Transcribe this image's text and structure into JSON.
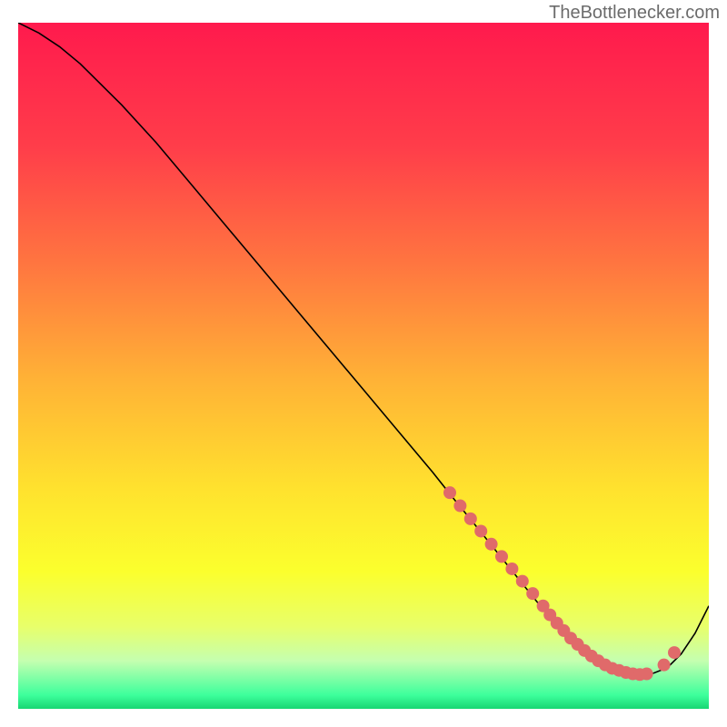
{
  "attribution": "TheBottlenecker.com",
  "chart_data": {
    "type": "line",
    "title": "",
    "xlabel": "",
    "ylabel": "",
    "xlim": [
      0,
      100
    ],
    "ylim": [
      0,
      100
    ],
    "background_type": "vertical_rainbow_gradient",
    "gradient_stops": [
      {
        "offset": 0,
        "color": "#ff1a4d"
      },
      {
        "offset": 0.18,
        "color": "#ff3d4a"
      },
      {
        "offset": 0.35,
        "color": "#ff7540"
      },
      {
        "offset": 0.52,
        "color": "#ffb236"
      },
      {
        "offset": 0.68,
        "color": "#ffe22e"
      },
      {
        "offset": 0.8,
        "color": "#fbff2d"
      },
      {
        "offset": 0.88,
        "color": "#e8ff6a"
      },
      {
        "offset": 0.93,
        "color": "#c5ffb0"
      },
      {
        "offset": 0.98,
        "color": "#3dff9c"
      },
      {
        "offset": 1.0,
        "color": "#18d673"
      }
    ],
    "series": [
      {
        "name": "bottleneck-curve",
        "color": "#000000",
        "stroke_width": 1.6,
        "x": [
          0,
          3,
          6,
          9,
          12,
          15,
          20,
          25,
          30,
          35,
          40,
          45,
          50,
          55,
          60,
          63,
          66,
          68,
          70,
          72,
          74,
          76,
          78,
          80,
          82,
          84,
          86,
          88,
          90,
          92,
          94,
          96,
          98,
          100
        ],
        "y": [
          100,
          98.5,
          96.5,
          94,
          91,
          88,
          82.5,
          76.5,
          70.5,
          64.5,
          58.5,
          52.5,
          46.5,
          40.5,
          34.5,
          30.7,
          27,
          24.5,
          22,
          19.5,
          17,
          14.5,
          12.2,
          10.2,
          8.5,
          7,
          5.9,
          5.2,
          5,
          5.2,
          6,
          8,
          11,
          15
        ]
      }
    ],
    "markers": [
      {
        "name": "data-cluster",
        "color": "#e06a6a",
        "size": 7,
        "x": [
          62.5,
          64,
          65.5,
          67,
          68.5,
          70,
          71.5,
          73,
          74.5,
          76,
          77,
          78,
          79,
          80,
          81,
          82,
          83,
          84,
          85,
          86,
          87,
          88,
          89,
          90,
          91,
          93.5,
          95
        ],
        "y": [
          31.5,
          29.6,
          27.7,
          25.9,
          24,
          22.2,
          20.4,
          18.6,
          16.8,
          15,
          13.7,
          12.5,
          11.4,
          10.3,
          9.4,
          8.5,
          7.7,
          7,
          6.4,
          5.9,
          5.6,
          5.3,
          5.1,
          5,
          5.1,
          6.4,
          8.2
        ]
      }
    ]
  }
}
